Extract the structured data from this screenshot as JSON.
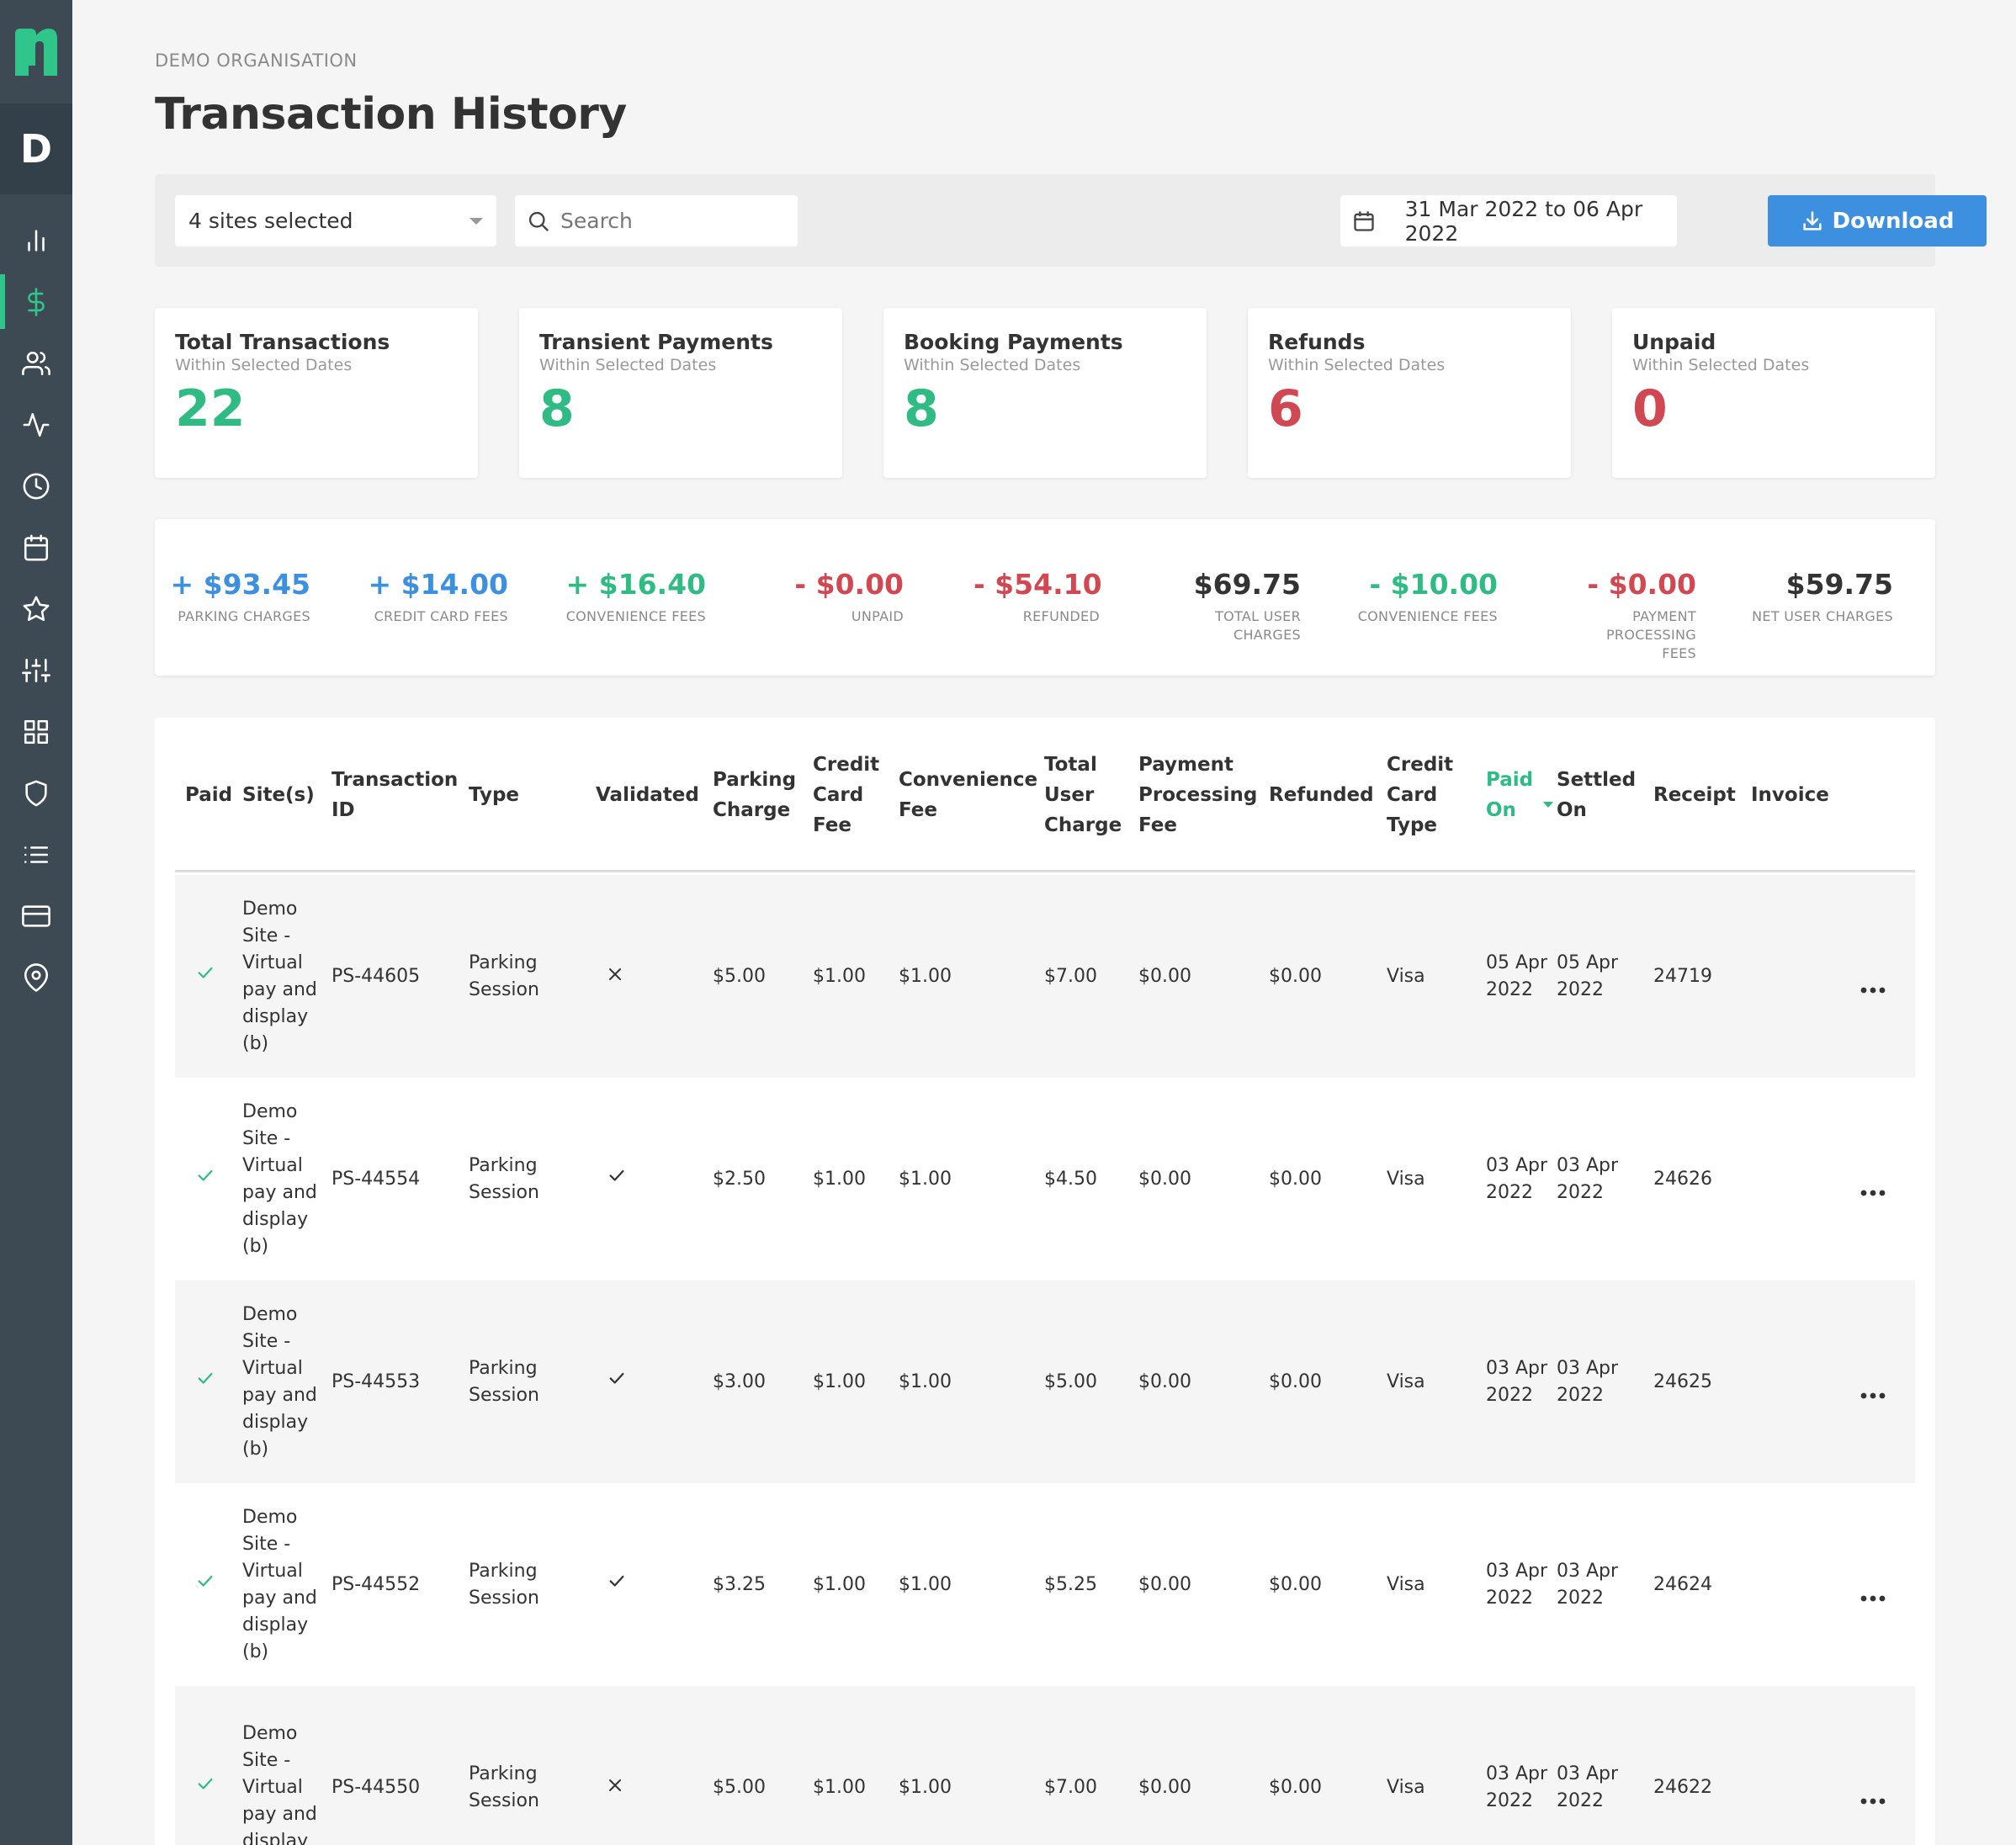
{
  "app": {
    "logo_letter": "n",
    "org_initial": "D",
    "brand_color": "#2fc58b"
  },
  "sidebar": {
    "items": [
      {
        "icon": "bar-chart-icon",
        "active": false
      },
      {
        "icon": "dollar-icon",
        "active": true
      },
      {
        "icon": "users-icon",
        "active": false
      },
      {
        "icon": "activity-icon",
        "active": false
      },
      {
        "icon": "clock-icon",
        "active": false
      },
      {
        "icon": "calendar-icon",
        "active": false
      },
      {
        "icon": "star-icon",
        "active": false
      },
      {
        "icon": "sliders-icon",
        "active": false
      },
      {
        "icon": "grid-icon",
        "active": false
      },
      {
        "icon": "shield-icon",
        "active": false
      },
      {
        "icon": "list-icon",
        "active": false
      },
      {
        "icon": "credit-card-icon",
        "active": false
      },
      {
        "icon": "map-pin-icon",
        "active": false
      }
    ]
  },
  "header": {
    "org_label": "DEMO ORGANISATION",
    "title": "Transaction History"
  },
  "toolbar": {
    "sites_select": "4 sites selected",
    "search_placeholder": "Search",
    "date_range": "31 Mar 2022 to 06 Apr 2022",
    "download_label": "Download"
  },
  "stats": [
    {
      "title": "Total Transactions",
      "subtitle": "Within Selected Dates",
      "value": "22",
      "tone": "green"
    },
    {
      "title": "Transient Payments",
      "subtitle": "Within Selected Dates",
      "value": "8",
      "tone": "green"
    },
    {
      "title": "Booking Payments",
      "subtitle": "Within Selected Dates",
      "value": "8",
      "tone": "green"
    },
    {
      "title": "Refunds",
      "subtitle": "Within Selected Dates",
      "value": "6",
      "tone": "red"
    },
    {
      "title": "Unpaid",
      "subtitle": "Within Selected Dates",
      "value": "0",
      "tone": "red"
    }
  ],
  "summary": [
    {
      "value": "+ $93.45",
      "label": "PARKING CHARGES",
      "tone": "blue"
    },
    {
      "value": "+ $14.00",
      "label": "CREDIT CARD FEES",
      "tone": "blue"
    },
    {
      "value": "+ $16.40",
      "label": "CONVENIENCE FEES",
      "tone": "green"
    },
    {
      "value": "- $0.00",
      "label": "UNPAID",
      "tone": "red"
    },
    {
      "value": "- $54.10",
      "label": "REFUNDED",
      "tone": "red"
    },
    {
      "value": "$69.75",
      "label": "TOTAL USER CHARGES",
      "tone": "dark"
    },
    {
      "value": "- $10.00",
      "label": "CONVENIENCE FEES",
      "tone": "green"
    },
    {
      "value": "- $0.00",
      "label": "PAYMENT PROCESSING FEES",
      "tone": "red"
    },
    {
      "value": "$59.75",
      "label": "NET USER CHARGES",
      "tone": "dark"
    }
  ],
  "table": {
    "columns": [
      "Paid",
      "Site(s)",
      "Transaction ID",
      "Type",
      "Validated",
      "Parking Charge",
      "Credit Card Fee",
      "Convenience Fee",
      "Total User Charge",
      "Payment Processing Fee",
      "Refunded",
      "Credit Card Type",
      "Paid On",
      "Settled On",
      "Receipt",
      "Invoice"
    ],
    "sorted_column": "Paid On",
    "rows": [
      {
        "paid": true,
        "site": "Demo Site - Virtual pay and display (b)",
        "id": "PS-44605",
        "type": "Parking Session",
        "validated": false,
        "parking": "$5.00",
        "cc_fee": "$1.00",
        "conv_fee": "$1.00",
        "total": "$7.00",
        "proc_fee": "$0.00",
        "refunded": "$0.00",
        "card": "Visa",
        "paid_on": "05 Apr 2022",
        "settled_on": "05 Apr 2022",
        "receipt": "24719",
        "invoice": ""
      },
      {
        "paid": true,
        "site": "Demo Site - Virtual pay and display (b)",
        "id": "PS-44554",
        "type": "Parking Session",
        "validated": true,
        "parking": "$2.50",
        "cc_fee": "$1.00",
        "conv_fee": "$1.00",
        "total": "$4.50",
        "proc_fee": "$0.00",
        "refunded": "$0.00",
        "card": "Visa",
        "paid_on": "03 Apr 2022",
        "settled_on": "03 Apr 2022",
        "receipt": "24626",
        "invoice": ""
      },
      {
        "paid": true,
        "site": "Demo Site - Virtual pay and display (b)",
        "id": "PS-44553",
        "type": "Parking Session",
        "validated": true,
        "parking": "$3.00",
        "cc_fee": "$1.00",
        "conv_fee": "$1.00",
        "total": "$5.00",
        "proc_fee": "$0.00",
        "refunded": "$0.00",
        "card": "Visa",
        "paid_on": "03 Apr 2022",
        "settled_on": "03 Apr 2022",
        "receipt": "24625",
        "invoice": ""
      },
      {
        "paid": true,
        "site": "Demo Site - Virtual pay and display (b)",
        "id": "PS-44552",
        "type": "Parking Session",
        "validated": true,
        "parking": "$3.25",
        "cc_fee": "$1.00",
        "conv_fee": "$1.00",
        "total": "$5.25",
        "proc_fee": "$0.00",
        "refunded": "$0.00",
        "card": "Visa",
        "paid_on": "03 Apr 2022",
        "settled_on": "03 Apr 2022",
        "receipt": "24624",
        "invoice": ""
      },
      {
        "paid": true,
        "site": "Demo Site - Virtual pay and display",
        "id": "PS-44550",
        "type": "Parking Session",
        "validated": false,
        "parking": "$5.00",
        "cc_fee": "$1.00",
        "conv_fee": "$1.00",
        "total": "$7.00",
        "proc_fee": "$0.00",
        "refunded": "$0.00",
        "card": "Visa",
        "paid_on": "03 Apr 2022",
        "settled_on": "03 Apr 2022",
        "receipt": "24622",
        "invoice": ""
      }
    ]
  }
}
